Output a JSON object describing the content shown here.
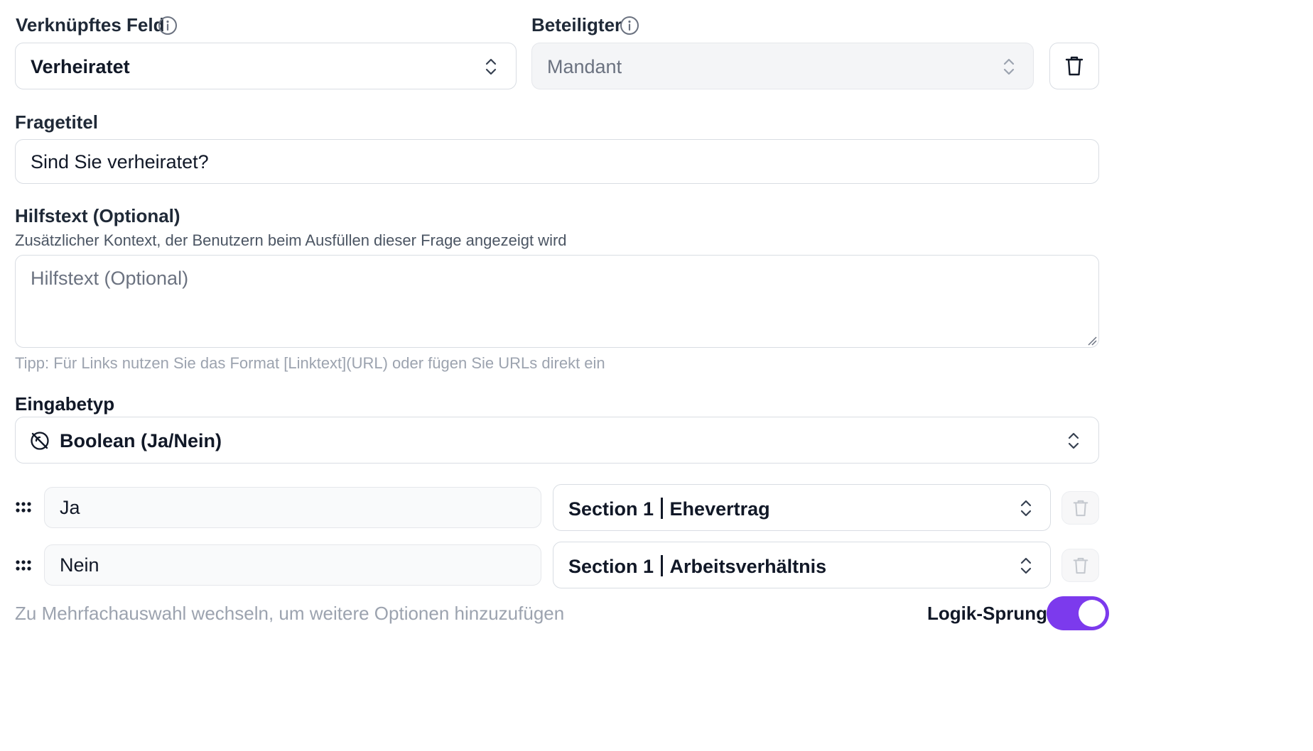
{
  "linked_field": {
    "label": "Verknüpftes Feld",
    "value": "Verheiratet"
  },
  "participant": {
    "label": "Beteiligter",
    "value": "Mandant"
  },
  "question_title": {
    "label": "Fragetitel",
    "value": "Sind Sie verheiratet?"
  },
  "help_text": {
    "label": "Hilfstext (Optional)",
    "description": "Zusätzlicher Kontext, der Benutzern beim Ausfüllen dieser Frage angezeigt wird",
    "placeholder": "Hilfstext (Optional)",
    "tip": "Tipp: Für Links nutzen Sie das Format [Linktext](URL) oder fügen Sie URLs direkt ein"
  },
  "input_type": {
    "label": "Eingabetyp",
    "value": "Boolean (Ja/Nein)"
  },
  "options": [
    {
      "label": "Ja",
      "target_section": "Section 1",
      "target_name": "Ehevertrag"
    },
    {
      "label": "Nein",
      "target_section": "Section 1",
      "target_name": "Arbeitsverhältnis"
    }
  ],
  "footer": {
    "hint": "Zu Mehrfachauswahl wechseln, um weitere Optionen hinzuzufügen",
    "logic_jump_label": "Logik-Sprung",
    "logic_jump_enabled": true
  },
  "colors": {
    "accent": "#7c3aed",
    "border": "#d9dde3"
  }
}
